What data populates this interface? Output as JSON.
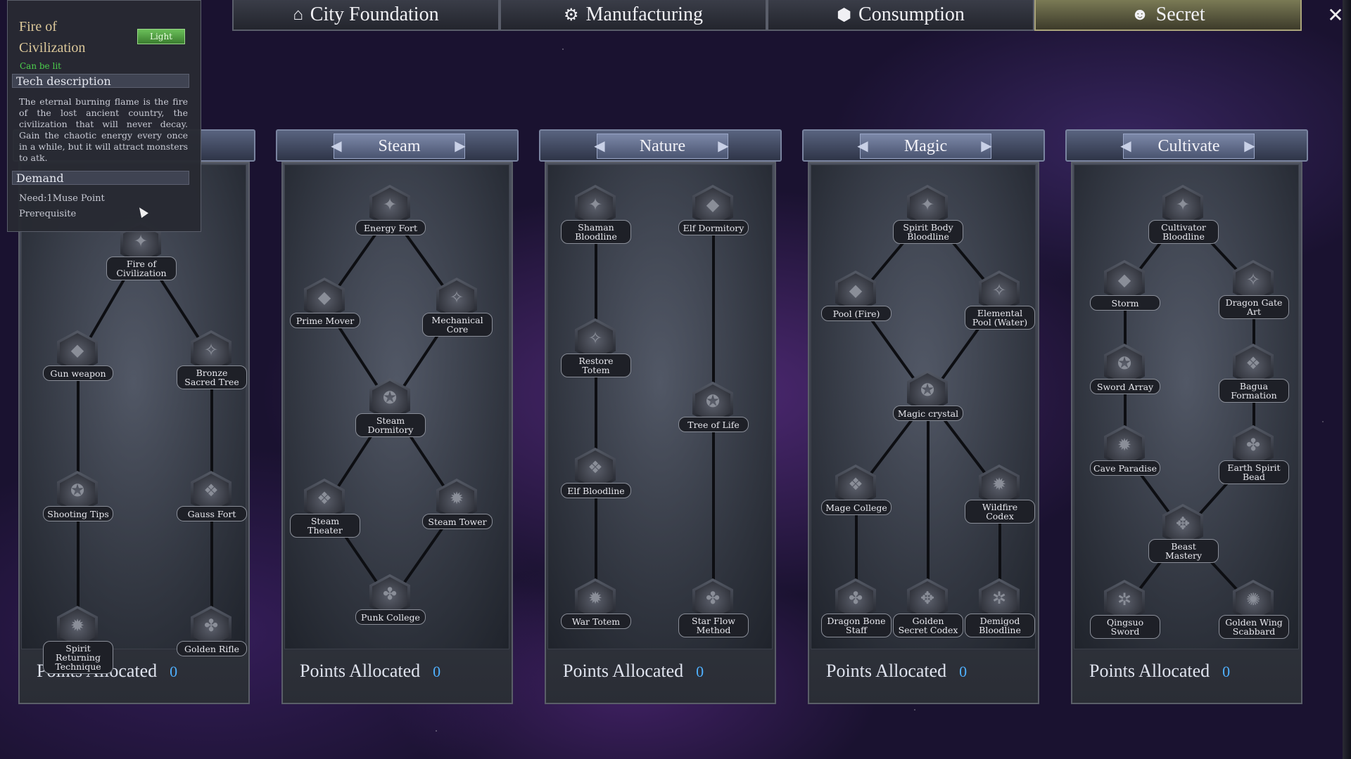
{
  "tabs": [
    {
      "label": "City Foundation",
      "icon": "house-icon",
      "glyph": "⌂",
      "active": false
    },
    {
      "label": "Manufacturing",
      "icon": "gear-icon",
      "glyph": "⚙",
      "active": false
    },
    {
      "label": "Consumption",
      "icon": "cube-icon",
      "glyph": "⬢",
      "active": false
    },
    {
      "label": "Secret",
      "icon": "head-icon",
      "glyph": "☻",
      "active": true
    }
  ],
  "close_label": "✕",
  "tooltip": {
    "title": "Fire of Civilization",
    "action_button": "Light",
    "status": "Can be lit",
    "desc_header": "Tech description",
    "description": "The eternal burning flame is the fire of the lost ancient country, the civilization that will never decay. Gain the chaotic energy every once in a while, but it will attract monsters to atk.",
    "demand_header": "Demand",
    "need": "Need:1Muse Point",
    "prerequisite": "Prerequisite"
  },
  "points_label": "Points Allocated",
  "panels": [
    {
      "title": "",
      "points": "0",
      "nodes": [
        {
          "label": "Fire of Civilization"
        },
        {
          "label": "Gun weapon"
        },
        {
          "label": "Bronze Sacred Tree"
        },
        {
          "label": "Shooting Tips"
        },
        {
          "label": "Gauss Fort"
        },
        {
          "label": "Spirit Returning Technique"
        },
        {
          "label": "Golden Rifle"
        }
      ]
    },
    {
      "title": "Steam",
      "points": "0",
      "nodes": [
        {
          "label": "Energy Fort"
        },
        {
          "label": "Prime Mover"
        },
        {
          "label": "Mechanical Core"
        },
        {
          "label": "Steam Dormitory"
        },
        {
          "label": "Steam Theater"
        },
        {
          "label": "Steam Tower"
        },
        {
          "label": "Punk College"
        }
      ]
    },
    {
      "title": "Nature",
      "points": "0",
      "nodes": [
        {
          "label": "Shaman Bloodline"
        },
        {
          "label": "Elf Dormitory"
        },
        {
          "label": "Restore Totem"
        },
        {
          "label": "Tree of Life"
        },
        {
          "label": "Elf Bloodline"
        },
        {
          "label": "War Totem"
        },
        {
          "label": "Star Flow Method"
        }
      ]
    },
    {
      "title": "Magic",
      "points": "0",
      "nodes": [
        {
          "label": "Spirit Body Bloodline"
        },
        {
          "label": "Pool (Fire)"
        },
        {
          "label": "Elemental Pool (Water)"
        },
        {
          "label": "Magic crystal"
        },
        {
          "label": "Mage College"
        },
        {
          "label": "Wildfire Codex"
        },
        {
          "label": "Dragon Bone Staff"
        },
        {
          "label": "Golden Secret Codex"
        },
        {
          "label": "Demigod Bloodline"
        }
      ]
    },
    {
      "title": "Cultivate",
      "points": "0",
      "nodes": [
        {
          "label": "Cultivator Bloodline"
        },
        {
          "label": "Storm"
        },
        {
          "label": "Dragon Gate Art"
        },
        {
          "label": "Sword Array"
        },
        {
          "label": "Bagua Formation"
        },
        {
          "label": "Cave Paradise"
        },
        {
          "label": "Earth Spirit Bead"
        },
        {
          "label": "Beast Mastery"
        },
        {
          "label": "Qingsuo Sword"
        },
        {
          "label": "Golden Wing Scabbard"
        }
      ]
    }
  ],
  "colors": {
    "points_value": "#4fb0ff",
    "status_green": "#4cd04c",
    "active_tab": "#7a7a55"
  }
}
